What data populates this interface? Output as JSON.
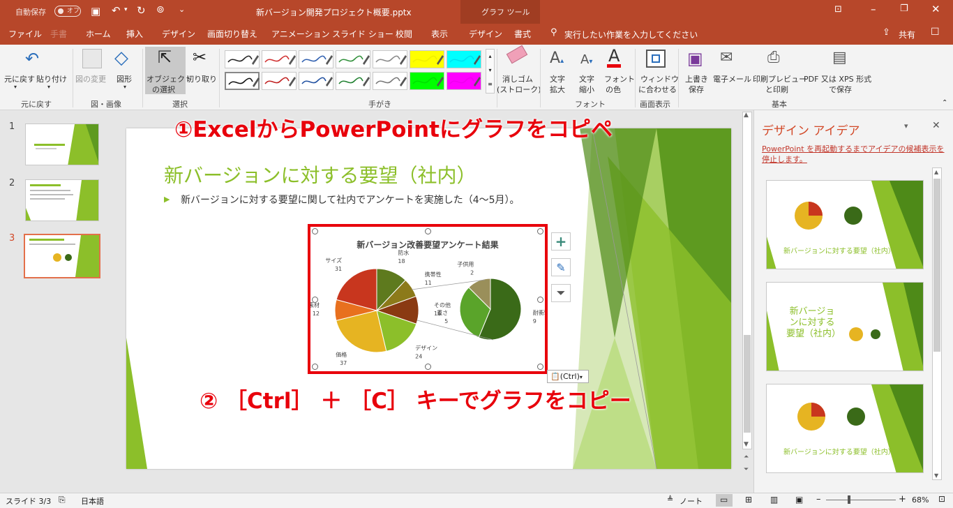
{
  "titlebar": {
    "autosave_label": "自動保存",
    "autosave_state": "オフ",
    "filename": "新バージョン開発プロジェクト概要.pptx",
    "context_tool": "グラフ ツール"
  },
  "tabs": [
    "ファイル",
    "手書",
    "ホーム",
    "挿入",
    "デザイン",
    "画面切り替え",
    "アニメーション",
    "スライド ショー",
    "校閲",
    "表示",
    "デザイン",
    "書式"
  ],
  "tell_me": "実行したい作業を入力してください",
  "share": "共有",
  "ribbon": {
    "undo": "元に戻す",
    "paste": "貼り付け",
    "group_undo": "元に戻す",
    "change_image": "図の変更",
    "shape": "図形",
    "group_image": "図・画像",
    "select_object_1": "オブジェクト",
    "select_object_2": "の選択",
    "lasso": "切り取り",
    "group_select": "選択",
    "group_pens": "手がき",
    "eraser_1": "消しゴム",
    "eraser_2": "(ストローク)",
    "grow_font_1": "文字",
    "grow_font_2": "拡大",
    "shrink_font_1": "文字",
    "shrink_font_2": "縮小",
    "font_color_1": "フォント",
    "font_color_2": "の色",
    "group_font": "フォント",
    "fit_window_1": "ウィンドウ",
    "fit_window_2": "に合わせる",
    "group_view": "画面表示",
    "save_1": "上書き",
    "save_2": "保存",
    "email": "電子メール",
    "print_1": "印刷プレビュー",
    "print_2": "と印刷",
    "pdf_1": "PDF 又は XPS 形式",
    "pdf_2": "で保存",
    "group_basic": "基本"
  },
  "pens": [
    {
      "color": "#222222",
      "highlight": "#ffffff"
    },
    {
      "color": "#d03030",
      "highlight": "#ffffff"
    },
    {
      "color": "#3060b0",
      "highlight": "#ffffff"
    },
    {
      "color": "#30903a",
      "highlight": "#ffffff"
    },
    {
      "color": "#888888",
      "highlight": "#ffffff"
    },
    {
      "color": "#f0f000",
      "highlight": "#ffff00"
    },
    {
      "color": "#00e0f0",
      "highlight": "#00ffff"
    },
    {
      "color": "#111111",
      "highlight": "#ffffff"
    },
    {
      "color": "#c02020",
      "highlight": "#ffffff"
    },
    {
      "color": "#2050a0",
      "highlight": "#ffffff"
    },
    {
      "color": "#208030",
      "highlight": "#ffffff"
    },
    {
      "color": "#777777",
      "highlight": "#ffffff"
    },
    {
      "color": "#00e000",
      "highlight": "#00ff00"
    },
    {
      "color": "#f000f0",
      "highlight": "#ff00ff"
    }
  ],
  "thumbnails": [
    {
      "num": "1",
      "active": false
    },
    {
      "num": "2",
      "active": false
    },
    {
      "num": "3",
      "active": true
    }
  ],
  "slide": {
    "title": "新バージョンに対する要望（社内）",
    "bullet": "新バージョンに対する要望に関して社内でアンケートを実施した（4〜5月）。",
    "paste_option": "(Ctrl)"
  },
  "overlays": {
    "step1": "①ExcelからPowerPointにグラフをコピペ",
    "step2": "② ［Ctrl］ ＋ ［C］ キーでグラフをコピー"
  },
  "chart_data": {
    "type": "pie",
    "title": "新バージョン改善要望アンケート結果",
    "slices": [
      {
        "label": "防水",
        "value": 18,
        "color": "#5e7a1e"
      },
      {
        "label": "携帯性",
        "value": 11,
        "color": "#8c7a1a"
      },
      {
        "label": "その他",
        "value": 16,
        "color": "#8a3a12"
      },
      {
        "label": "デザイン",
        "value": 24,
        "color": "#8cbf2a"
      },
      {
        "label": "価格",
        "value": 37,
        "color": "#e6b422"
      },
      {
        "label": "素材",
        "value": 12,
        "color": "#e8701e"
      },
      {
        "label": "サイズ",
        "value": 31,
        "color": "#c8361e"
      }
    ],
    "sub_slices": [
      {
        "label": "耐衝撃機能",
        "value": 9,
        "color": "#3a6a18"
      },
      {
        "label": "重さ",
        "value": 5,
        "color": "#5aa42a"
      },
      {
        "label": "子供用",
        "value": 2,
        "color": "#9a8f5a"
      }
    ]
  },
  "ideas": {
    "title": "デザイン アイデア",
    "notice": "PowerPoint を再起動するまでアイデアの候補表示を停止します。",
    "card1_title": "新バージョンに対する要望（社内）",
    "card2_title": "新バージョンに対する要望（社内）",
    "card3_title": "新バージョンに対する要望（社内）"
  },
  "status": {
    "slide": "スライド 3/3",
    "lang": "日本語",
    "notes": "ノート",
    "zoom": "68%"
  },
  "colors": {
    "accent": "#b7472a",
    "green": "#8cbf2a",
    "overlay_red": "#e8000b"
  }
}
